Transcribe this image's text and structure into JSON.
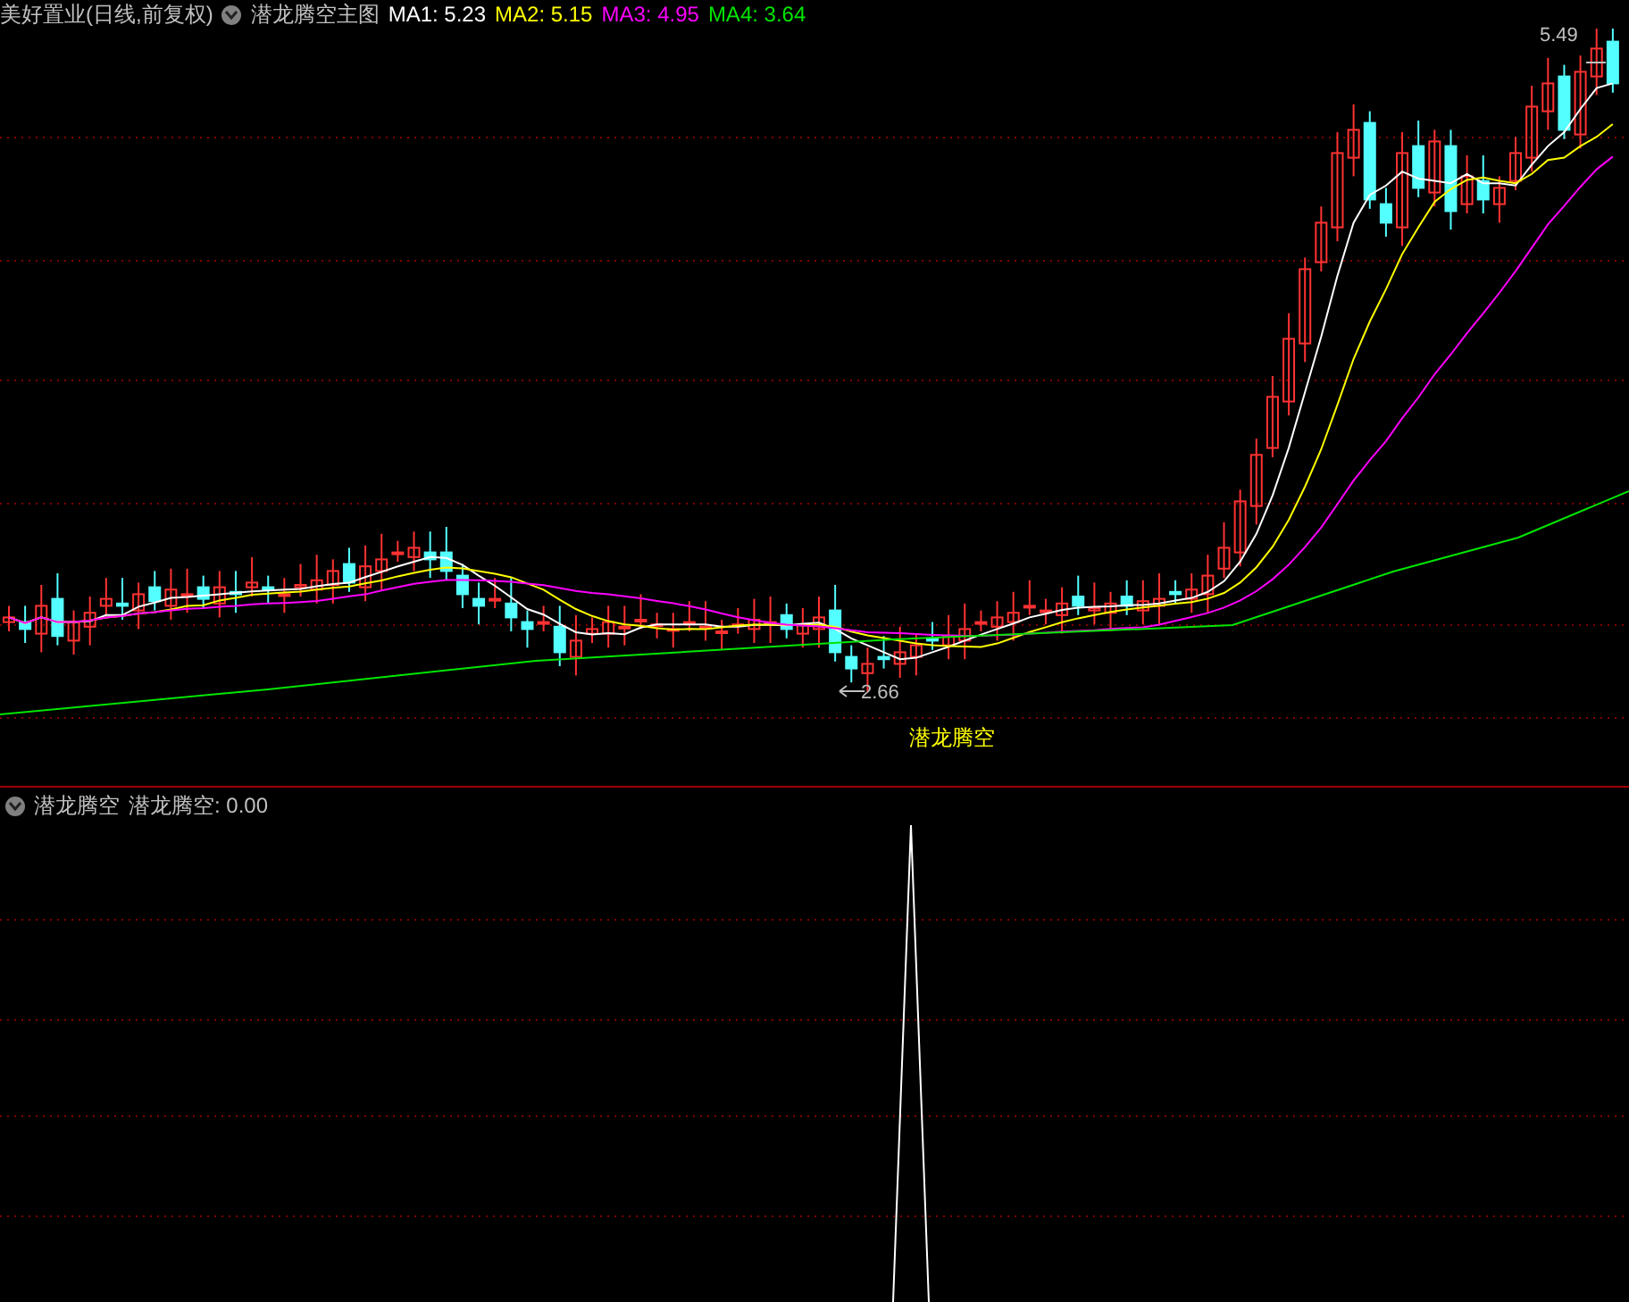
{
  "price_panel": {
    "title": "美好置业(日线,前复权)",
    "formula": "潜龙腾空主图",
    "ma": [
      {
        "label": "MA1: 5.23",
        "color": "#ffffff"
      },
      {
        "label": "MA2: 5.15",
        "color": "#ffff00"
      },
      {
        "label": "MA3: 4.95",
        "color": "#ff00ff"
      },
      {
        "label": "MA4: 3.64",
        "color": "#00e600"
      }
    ],
    "high_label": "5.49",
    "low_label": "2.66",
    "signal_label": "潜龙腾空"
  },
  "indicator_panel": {
    "name": "潜龙腾空",
    "readout": "潜龙腾空: 0.00"
  }
}
